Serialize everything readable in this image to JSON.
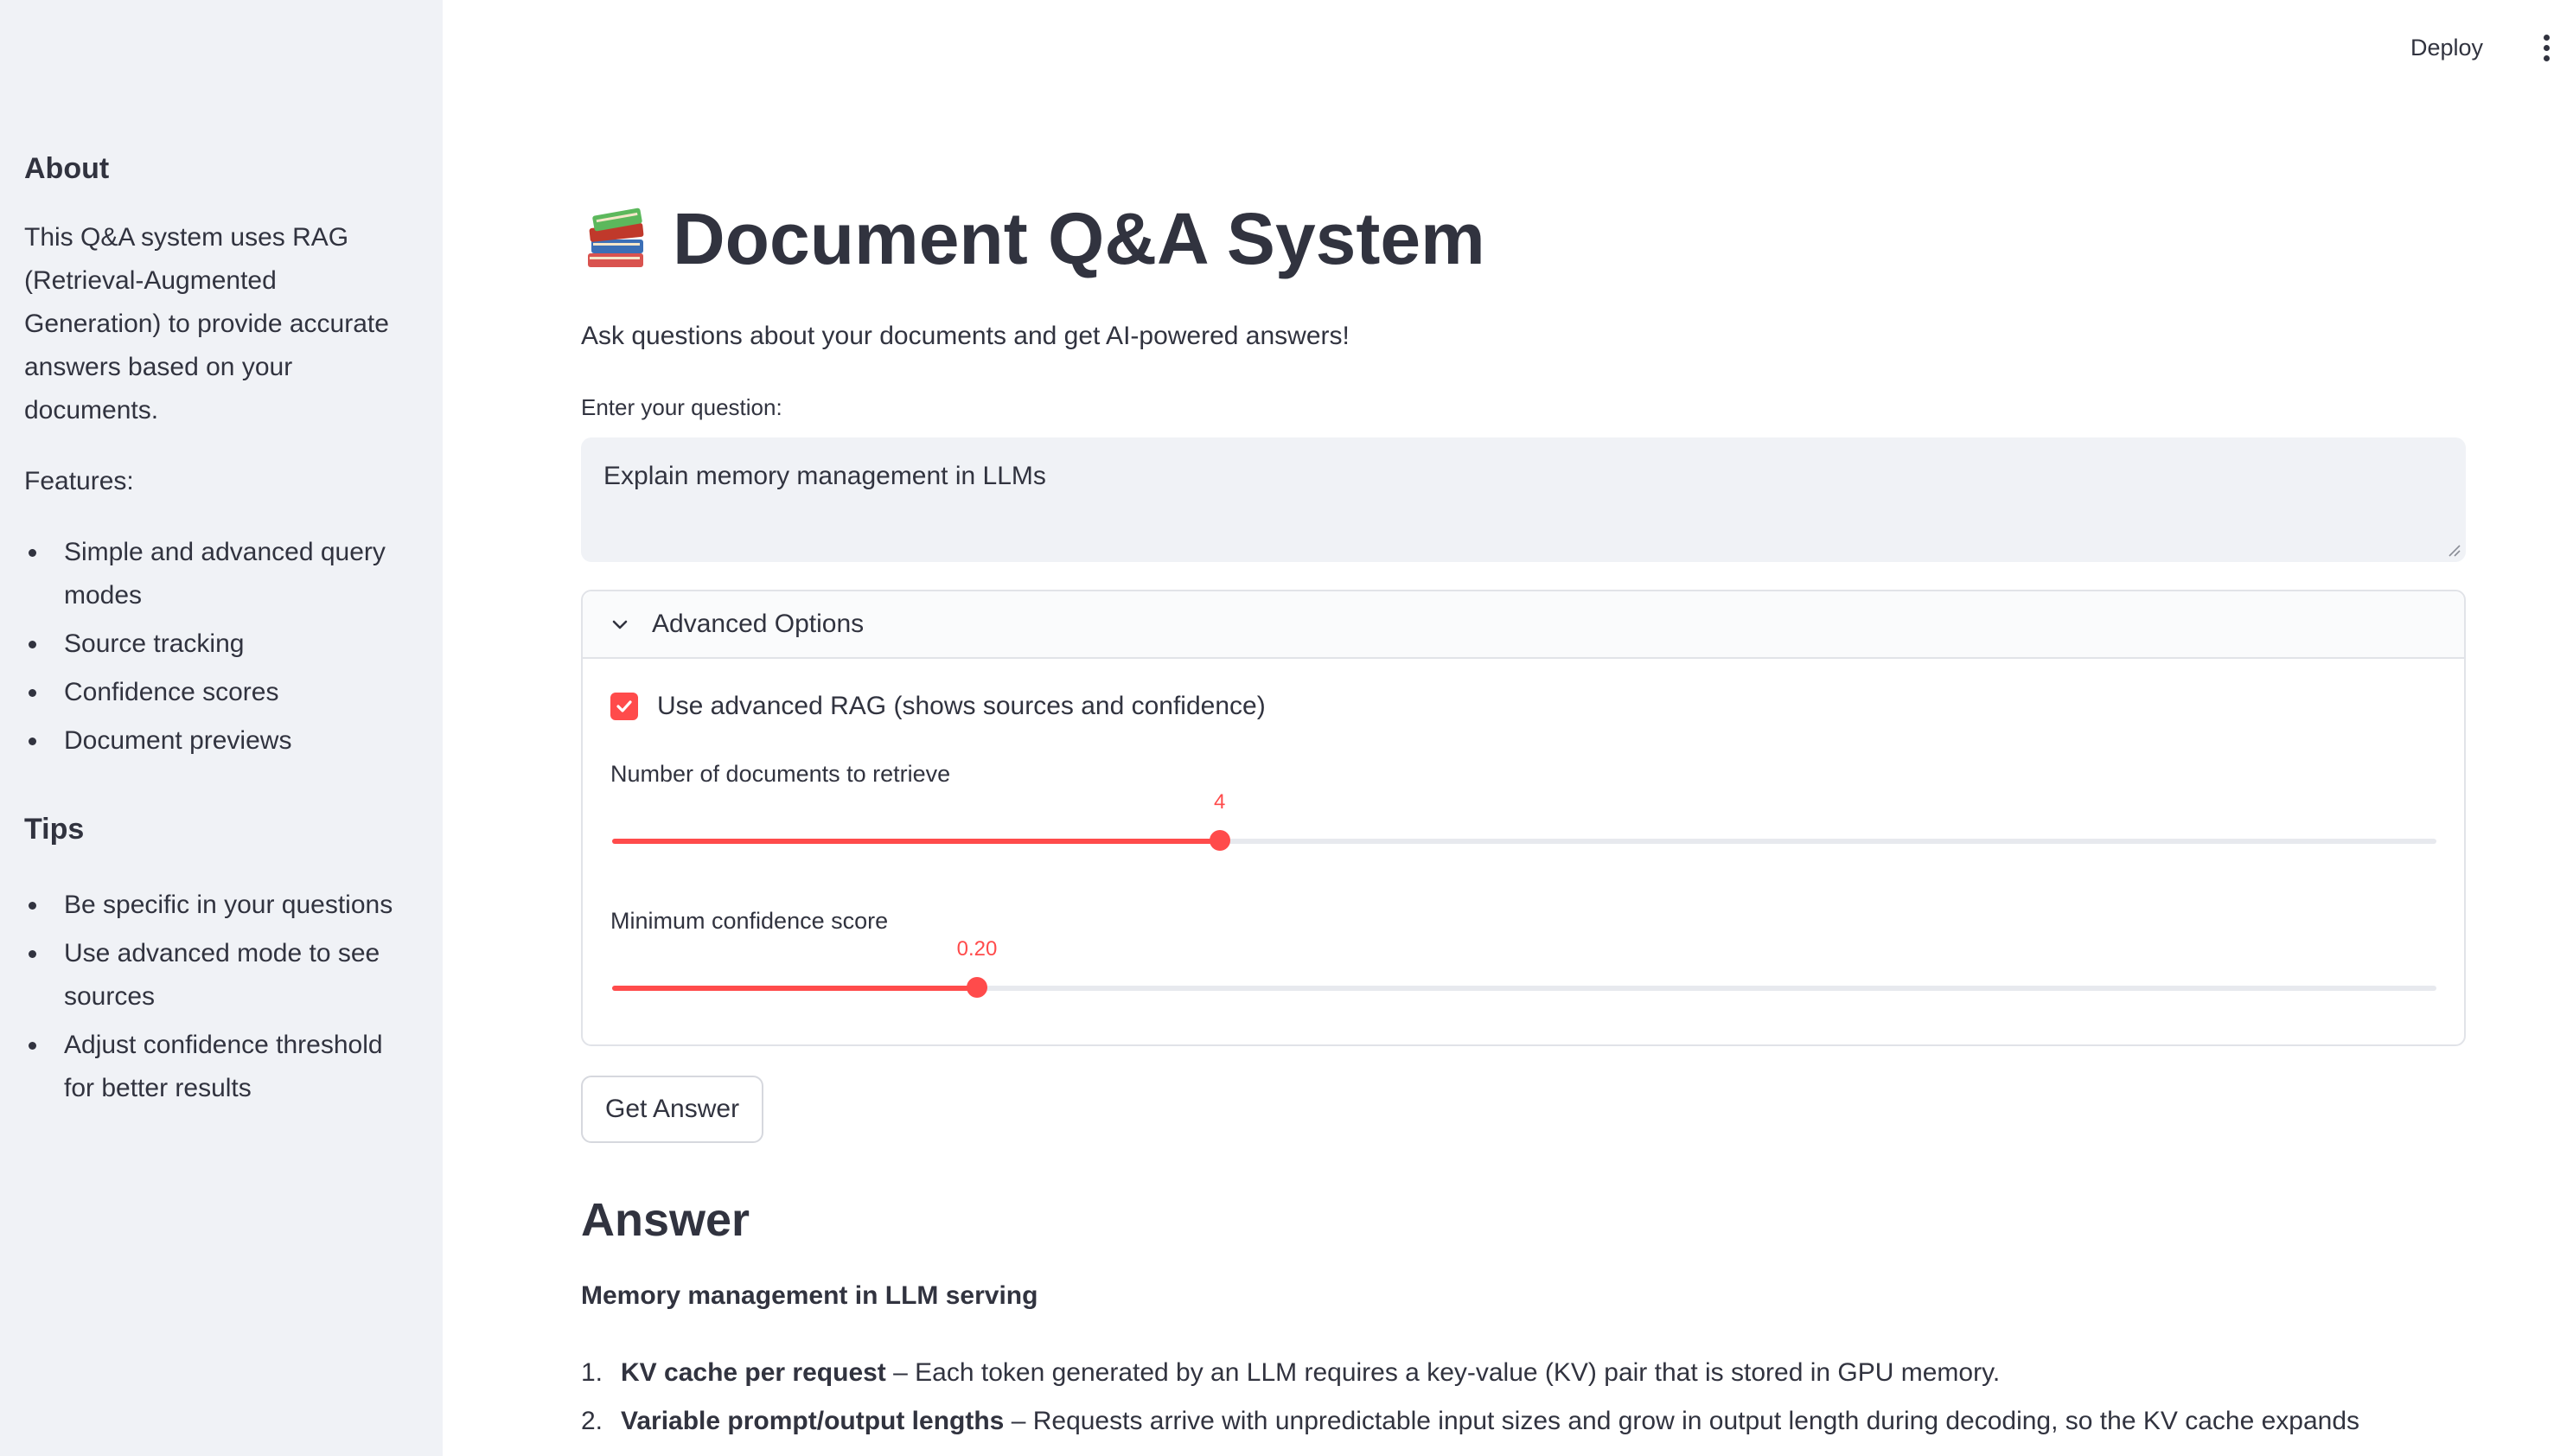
{
  "header": {
    "deploy_label": "Deploy",
    "menu_icon": "more-vert-icon"
  },
  "sidebar": {
    "about_title": "About",
    "about_text": "This Q&A system uses RAG (Retrieval-Augmented Generation) to provide accurate answers based on your documents.",
    "features_label": "Features:",
    "features": [
      "Simple and advanced query modes",
      "Source tracking",
      "Confidence scores",
      "Document previews"
    ],
    "tips_title": "Tips",
    "tips": [
      "Be specific in your questions",
      "Use advanced mode to see sources",
      "Adjust confidence threshold for better results"
    ]
  },
  "main": {
    "title_icon": "books-icon",
    "title": "Document Q&A System",
    "subtitle": "Ask questions about your documents and get AI-powered answers!",
    "question_label": "Enter your question:",
    "question_value": "Explain memory management in LLMs",
    "advanced": {
      "label": "Advanced Options",
      "checkbox_label": "Use advanced RAG (shows sources and confidence)",
      "checkbox_checked": true,
      "docs_slider": {
        "label": "Number of documents to retrieve",
        "value": "4",
        "fraction": 0.333
      },
      "confidence_slider": {
        "label": "Minimum confidence score",
        "value": "0.20",
        "fraction": 0.2
      }
    },
    "button_label": "Get Answer",
    "answer": {
      "heading": "Answer",
      "subheading": "Memory management in LLM serving",
      "items": [
        {
          "num": "1.",
          "bold": "KV cache per request",
          "text": " – Each token generated by an LLM requires a key-value (KV) pair that is stored in GPU memory."
        },
        {
          "num": "2.",
          "bold": "Variable prompt/output lengths",
          "text": " – Requests arrive with unpredictable input sizes and grow in output length during decoding, so the KV cache expands"
        }
      ]
    }
  },
  "colors": {
    "accent": "#ff4b4b",
    "sidebar_bg": "#f0f2f6",
    "text": "#31333f"
  }
}
